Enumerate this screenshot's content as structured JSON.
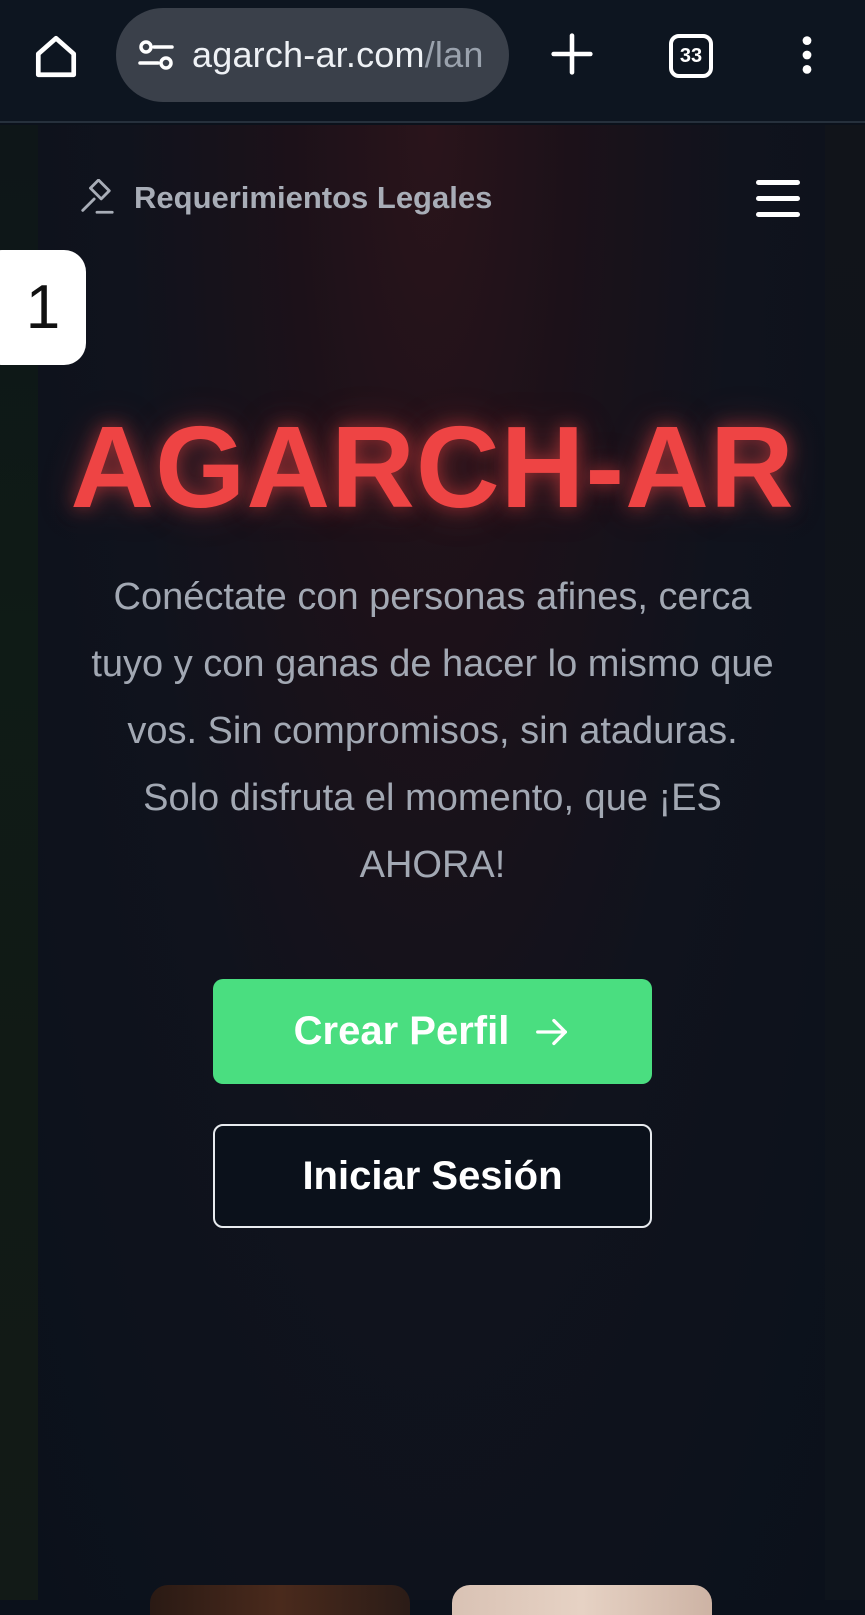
{
  "browser": {
    "url_host": "agarch-ar.com",
    "url_path": "/lan",
    "tab_count": "33",
    "icons": [
      "home-icon",
      "tune-icon",
      "plus-icon",
      "tabs-icon",
      "more-vert-icon"
    ]
  },
  "tab_badge": {
    "number": "1"
  },
  "page": {
    "legal_link": "Requerimientos Legales",
    "hero": {
      "title": "AGARCH-AR",
      "subtitle": "Conéctate con personas afines, cerca tuyo y con ganas de hacer lo mismo que vos. Sin compromisos, sin ataduras. Solo disfruta el momento, que ¡ES AHORA!"
    },
    "buttons": {
      "primary": "Crear Perfil",
      "secondary": "Iniciar Sesión"
    }
  },
  "colors": {
    "title_red": "#ee4444",
    "primary_green": "#4ade80",
    "background": "#0b111b",
    "muted_text": "#a2a8b3"
  }
}
